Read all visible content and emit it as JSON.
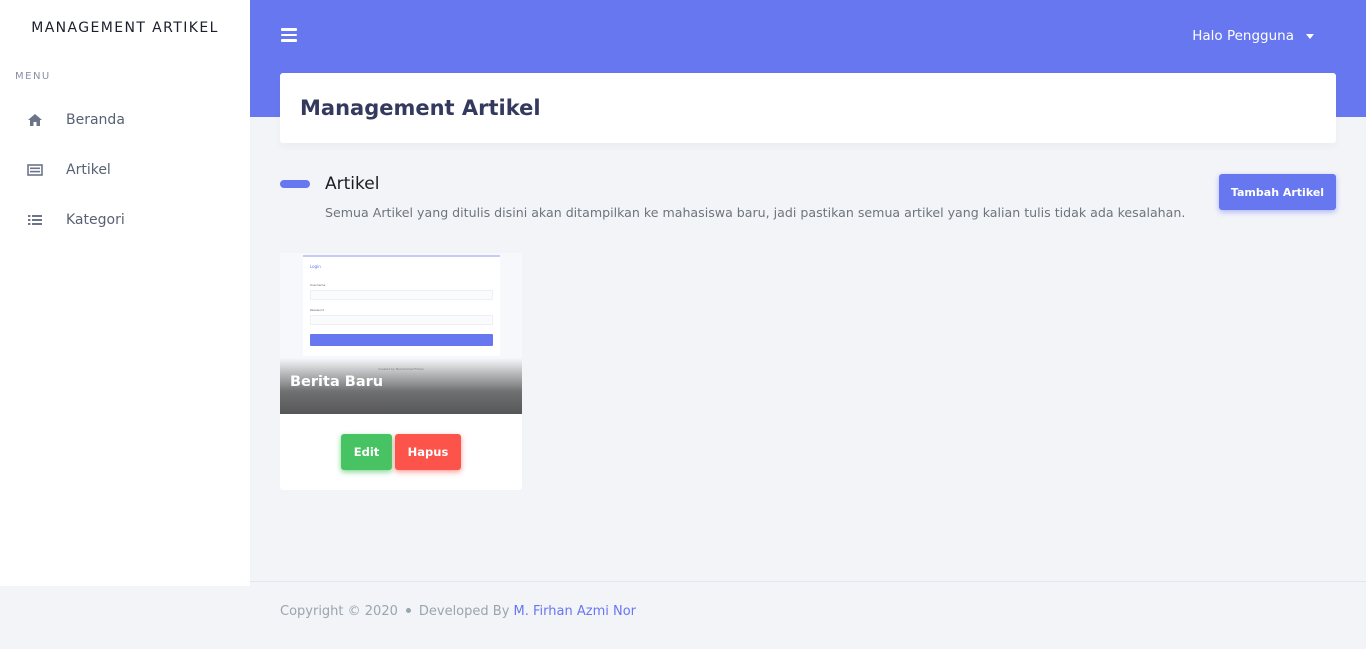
{
  "sidebar": {
    "brand": "MANAGEMENT ARTIKEL",
    "menu_label": "MENU",
    "items": [
      {
        "label": "Beranda",
        "icon": "home-icon"
      },
      {
        "label": "Artikel",
        "icon": "newspaper-icon"
      },
      {
        "label": "Kategori",
        "icon": "list-icon"
      }
    ]
  },
  "header": {
    "user_greeting": "Halo Pengguna"
  },
  "page": {
    "title": "Management Artikel"
  },
  "section": {
    "title": "Artikel",
    "description": "Semua Artikel yang ditulis disini akan ditampilkan ke mahasiswa baru, jadi pastikan semua artikel yang kalian tulis tidak ada kesalahan.",
    "add_button": "Tambah Artikel"
  },
  "articles": [
    {
      "title": "Berita Baru",
      "thumbnail": {
        "heading": "Login",
        "field1_label": "Username",
        "field2_label": "Password",
        "button": "Login",
        "credit": "Created by Muhammad Firhan"
      },
      "edit_label": "Edit",
      "delete_label": "Hapus"
    }
  ],
  "footer": {
    "copyright": "Copyright © 2020",
    "developed_by": "Developed By",
    "author": "M. Firhan Azmi Nor"
  },
  "colors": {
    "primary": "#6777ef",
    "success": "#47c363",
    "danger": "#fc544b"
  }
}
